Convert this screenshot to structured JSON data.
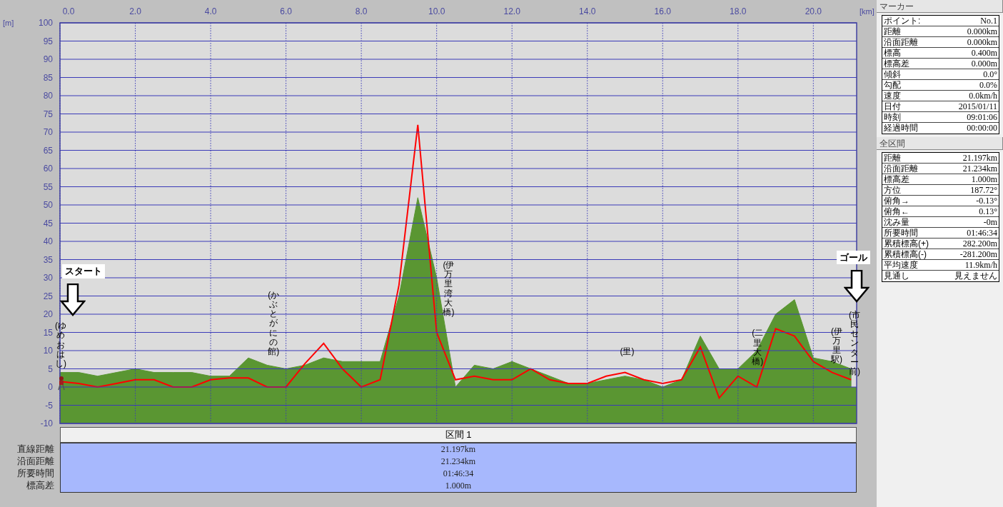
{
  "chart": {
    "y_unit": "[m]",
    "x_unit": "[km]",
    "landmarks": [
      {
        "kind": "flag",
        "text": "スタート"
      },
      {
        "kind": "label",
        "text": "(ゆめおはし)"
      },
      {
        "kind": "label",
        "text": "(かぶとがにの館)"
      },
      {
        "kind": "label",
        "text": "(伊万里湾大橋)"
      },
      {
        "kind": "label",
        "text": "(里)"
      },
      {
        "kind": "label",
        "text": "(二里大橋)"
      },
      {
        "kind": "label",
        "text": "(伊万里駅)"
      },
      {
        "kind": "flag",
        "text": "ゴール"
      },
      {
        "kind": "label",
        "text": "(市民センター前)"
      }
    ],
    "chart_data": {
      "type": "area",
      "grid": true,
      "bands": [
        {
          "axis": "y",
          "from": -10,
          "to": 0,
          "color": "#5a9632"
        }
      ],
      "xlim": [
        0,
        21.15
      ],
      "ylim": [
        -10,
        100
      ],
      "xticks": [
        {
          "value": 0,
          "label": "0.0"
        },
        {
          "value": 2,
          "label": "2.0"
        },
        {
          "value": 4,
          "label": "4.0"
        },
        {
          "value": 6,
          "label": "6.0"
        },
        {
          "value": 8,
          "label": "8.0"
        },
        {
          "value": 10,
          "label": "10.0"
        },
        {
          "value": 12,
          "label": "12.0"
        },
        {
          "value": 14,
          "label": "14.0"
        },
        {
          "value": 16,
          "label": "16.0"
        },
        {
          "value": 18,
          "label": "18.0"
        },
        {
          "value": 20,
          "label": "20.0"
        }
      ],
      "yticks": [
        -10,
        -5,
        0,
        5,
        10,
        15,
        20,
        25,
        30,
        35,
        40,
        45,
        50,
        55,
        60,
        65,
        70,
        75,
        80,
        85,
        90,
        95,
        100
      ],
      "x": [
        0,
        0.5,
        1,
        1.5,
        2,
        2.5,
        3,
        3.5,
        4,
        4.5,
        5,
        5.5,
        6,
        6.5,
        7,
        7.5,
        8,
        8.5,
        9,
        9.5,
        10,
        10.5,
        11,
        11.5,
        12,
        12.5,
        13,
        13.5,
        14,
        14.5,
        15,
        15.5,
        16,
        16.5,
        17,
        17.5,
        18,
        18.5,
        19,
        19.5,
        20,
        20.5,
        21
      ],
      "series": [
        {
          "type": "area",
          "color": "#5a9632",
          "values": [
            4,
            4,
            3,
            4,
            5,
            4,
            4,
            4,
            3,
            3,
            8,
            6,
            5,
            6,
            8,
            7,
            7,
            7,
            25,
            52,
            30,
            0,
            6,
            5,
            7,
            5,
            3,
            1,
            1,
            2,
            3,
            2,
            0,
            2,
            14,
            5,
            5,
            10,
            20,
            24,
            8,
            7,
            5
          ]
        },
        {
          "type": "line",
          "color": "#ff0000",
          "values": [
            1.5,
            1,
            0,
            1,
            2,
            2,
            0,
            0,
            2,
            2.5,
            2.5,
            0,
            0,
            6.4,
            12,
            5,
            0,
            2,
            28,
            72,
            15,
            2,
            3,
            2,
            2,
            5,
            2,
            1,
            1,
            3,
            4,
            2,
            1,
            2,
            11,
            -3,
            3,
            0,
            16,
            14,
            7,
            4,
            2
          ]
        }
      ]
    }
  },
  "section_table": {
    "header": "区間 1",
    "rows": [
      {
        "label": "直線距離",
        "value": "21.197km"
      },
      {
        "label": "沿面距離",
        "value": "21.234km"
      },
      {
        "label": "所要時間",
        "value": "01:46:34"
      },
      {
        "label": "標高差",
        "value": "1.000m"
      }
    ]
  },
  "marker_panel": {
    "title": "マーカー",
    "rows": [
      {
        "label": "ポイント:",
        "value": "No.1"
      },
      {
        "label": "距離",
        "value": "0.000km"
      },
      {
        "label": "沿面距離",
        "value": "0.000km"
      },
      {
        "label": "標高",
        "value": "0.400m"
      },
      {
        "label": "標高差",
        "value": "0.000m"
      },
      {
        "label": "傾斜",
        "value": "0.0°"
      },
      {
        "label": "勾配",
        "value": "0.0%"
      },
      {
        "label": "速度",
        "value": "0.0km/h"
      },
      {
        "label": "日付",
        "value": "2015/01/11"
      },
      {
        "label": "時刻",
        "value": "09:01:06"
      },
      {
        "label": "経過時間",
        "value": "00:00:00"
      }
    ]
  },
  "total_panel": {
    "title": "全区間",
    "rows": [
      {
        "label": "距離",
        "value": "21.197km"
      },
      {
        "label": "沿面距離",
        "value": "21.234km"
      },
      {
        "label": "標高差",
        "value": "1.000m"
      },
      {
        "label": "方位",
        "value": "187.72°"
      },
      {
        "label": "俯角→",
        "value": "-0.13°"
      },
      {
        "label": "俯角←",
        "value": "0.13°"
      },
      {
        "label": "沈み量",
        "value": "-0m"
      },
      {
        "label": "所要時間",
        "value": "01:46:34"
      },
      {
        "label": "累積標高(+)",
        "value": "282.200m"
      },
      {
        "label": "累積標高(-)",
        "value": "-281.200m"
      },
      {
        "label": "平均速度",
        "value": "11.9km/h"
      },
      {
        "label": "見通し",
        "value": "見えません"
      }
    ]
  }
}
